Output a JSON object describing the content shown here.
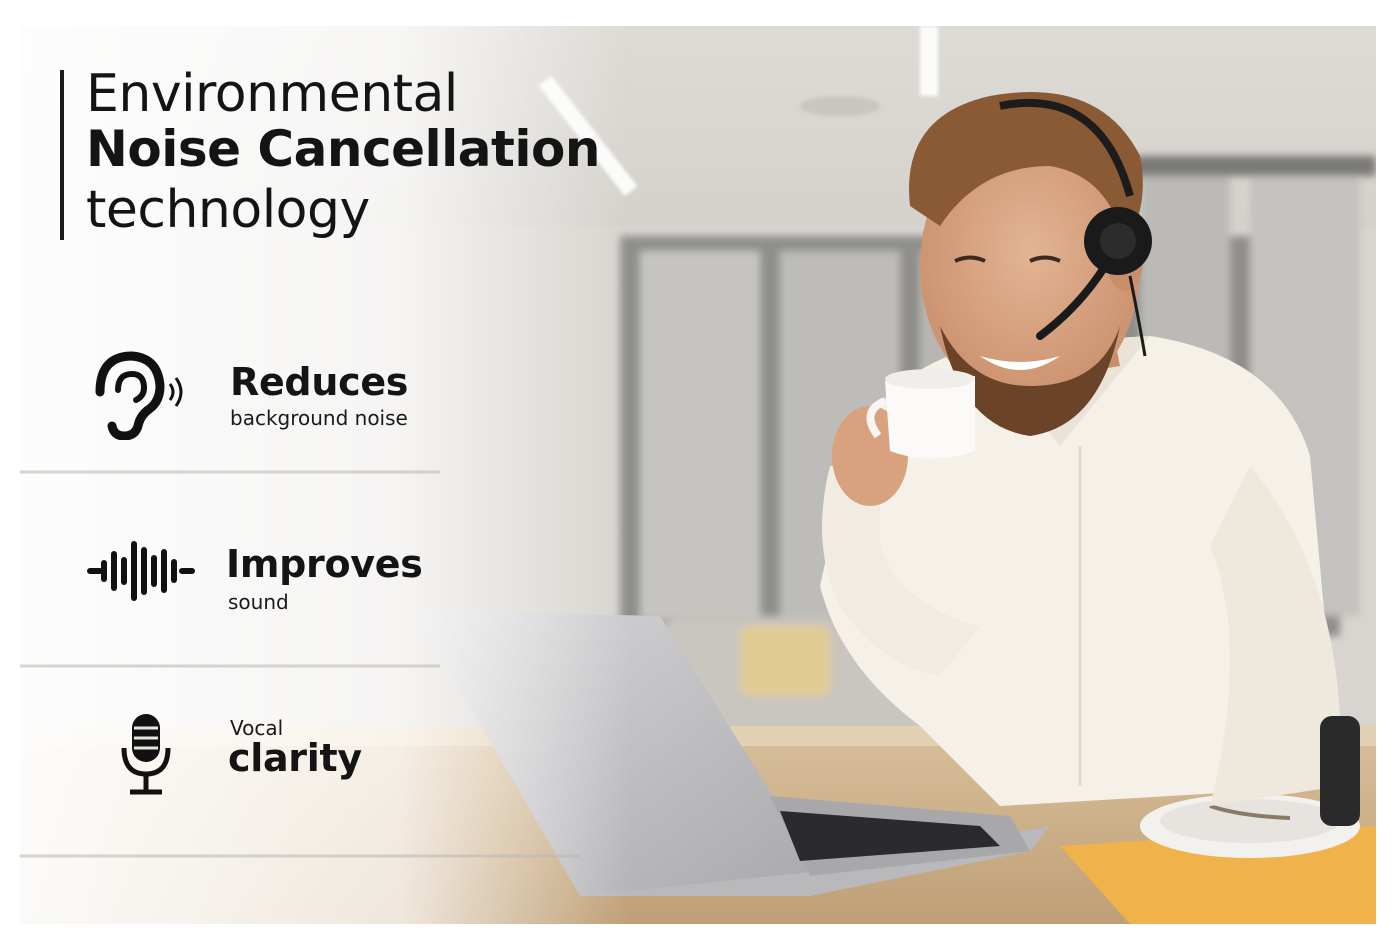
{
  "headline": {
    "line1": "Environmental",
    "line2": "Noise Cancellation",
    "line3": "technology"
  },
  "features": [
    {
      "icon": "ear-sound-icon",
      "title": "Reduces",
      "subtitle": "background noise"
    },
    {
      "icon": "sound-wave-icon",
      "title": "Improves",
      "subtitle": "sound"
    },
    {
      "icon": "microphone-icon",
      "title": "clarity",
      "subtitle": "Vocal"
    }
  ],
  "photo": {
    "subject": "man-with-headset-icon",
    "colors": {
      "wall": "#e9e6e1",
      "desk": "#cbb08a",
      "shirt": "#f5f0e8",
      "laptop": "#c7c7c9",
      "notebook": "#f0b24a"
    }
  }
}
